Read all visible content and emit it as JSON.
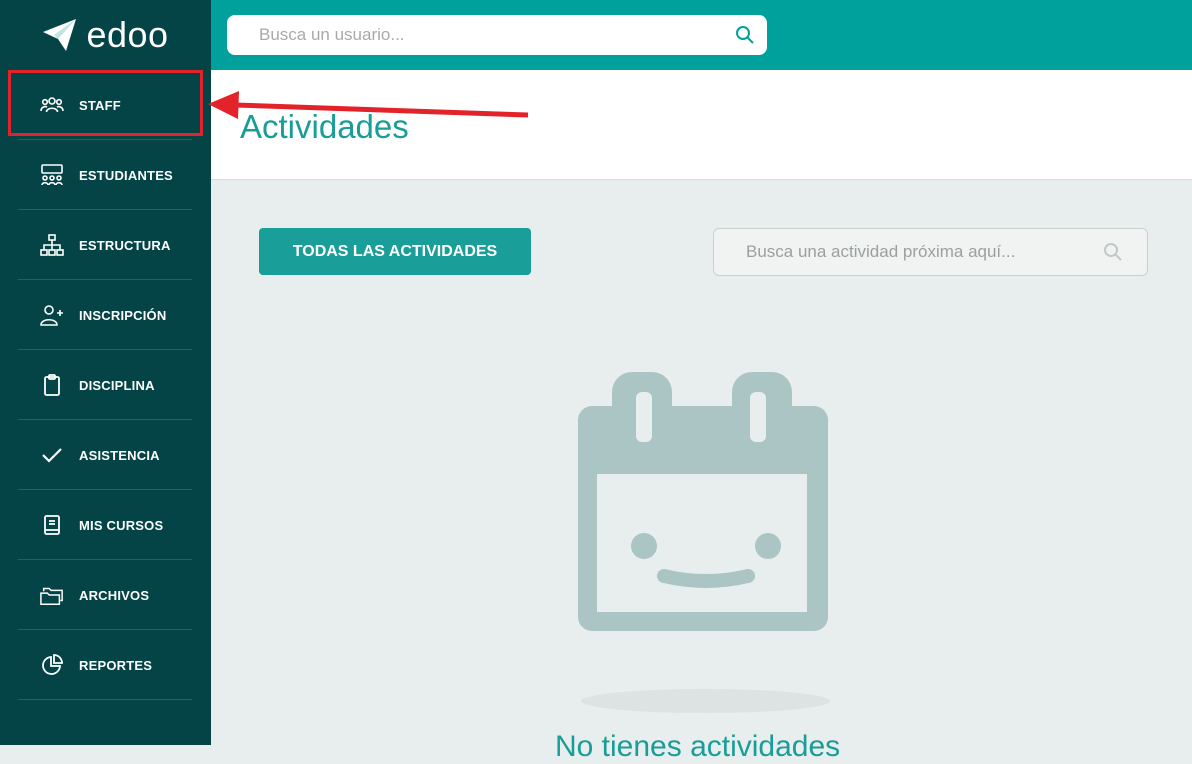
{
  "brand": {
    "name": "edoo"
  },
  "topbar": {
    "search_placeholder": "Busca un usuario..."
  },
  "sidebar": {
    "items": [
      {
        "label": "STAFF",
        "icon": "users-icon"
      },
      {
        "label": "ESTUDIANTES",
        "icon": "students-icon"
      },
      {
        "label": "ESTRUCTURA",
        "icon": "hierarchy-icon"
      },
      {
        "label": "INSCRIPCIÓN",
        "icon": "user-add-icon"
      },
      {
        "label": "DISCIPLINA",
        "icon": "clipboard-icon"
      },
      {
        "label": "ASISTENCIA",
        "icon": "check-icon"
      },
      {
        "label": "MIS CURSOS",
        "icon": "book-icon"
      },
      {
        "label": "ARCHIVOS",
        "icon": "folders-icon"
      },
      {
        "label": "REPORTES",
        "icon": "pie-chart-icon"
      }
    ]
  },
  "page": {
    "title": "Actividades",
    "all_activities_button": "TODAS LAS ACTIVIDADES",
    "activity_search_placeholder": "Busca una actividad próxima aquí...",
    "empty_text": "No tienes actividades"
  },
  "colors": {
    "sidebar": "#044447",
    "topbar": "#00a19d",
    "accent": "#1a9e99",
    "annotation": "#e2232a"
  }
}
